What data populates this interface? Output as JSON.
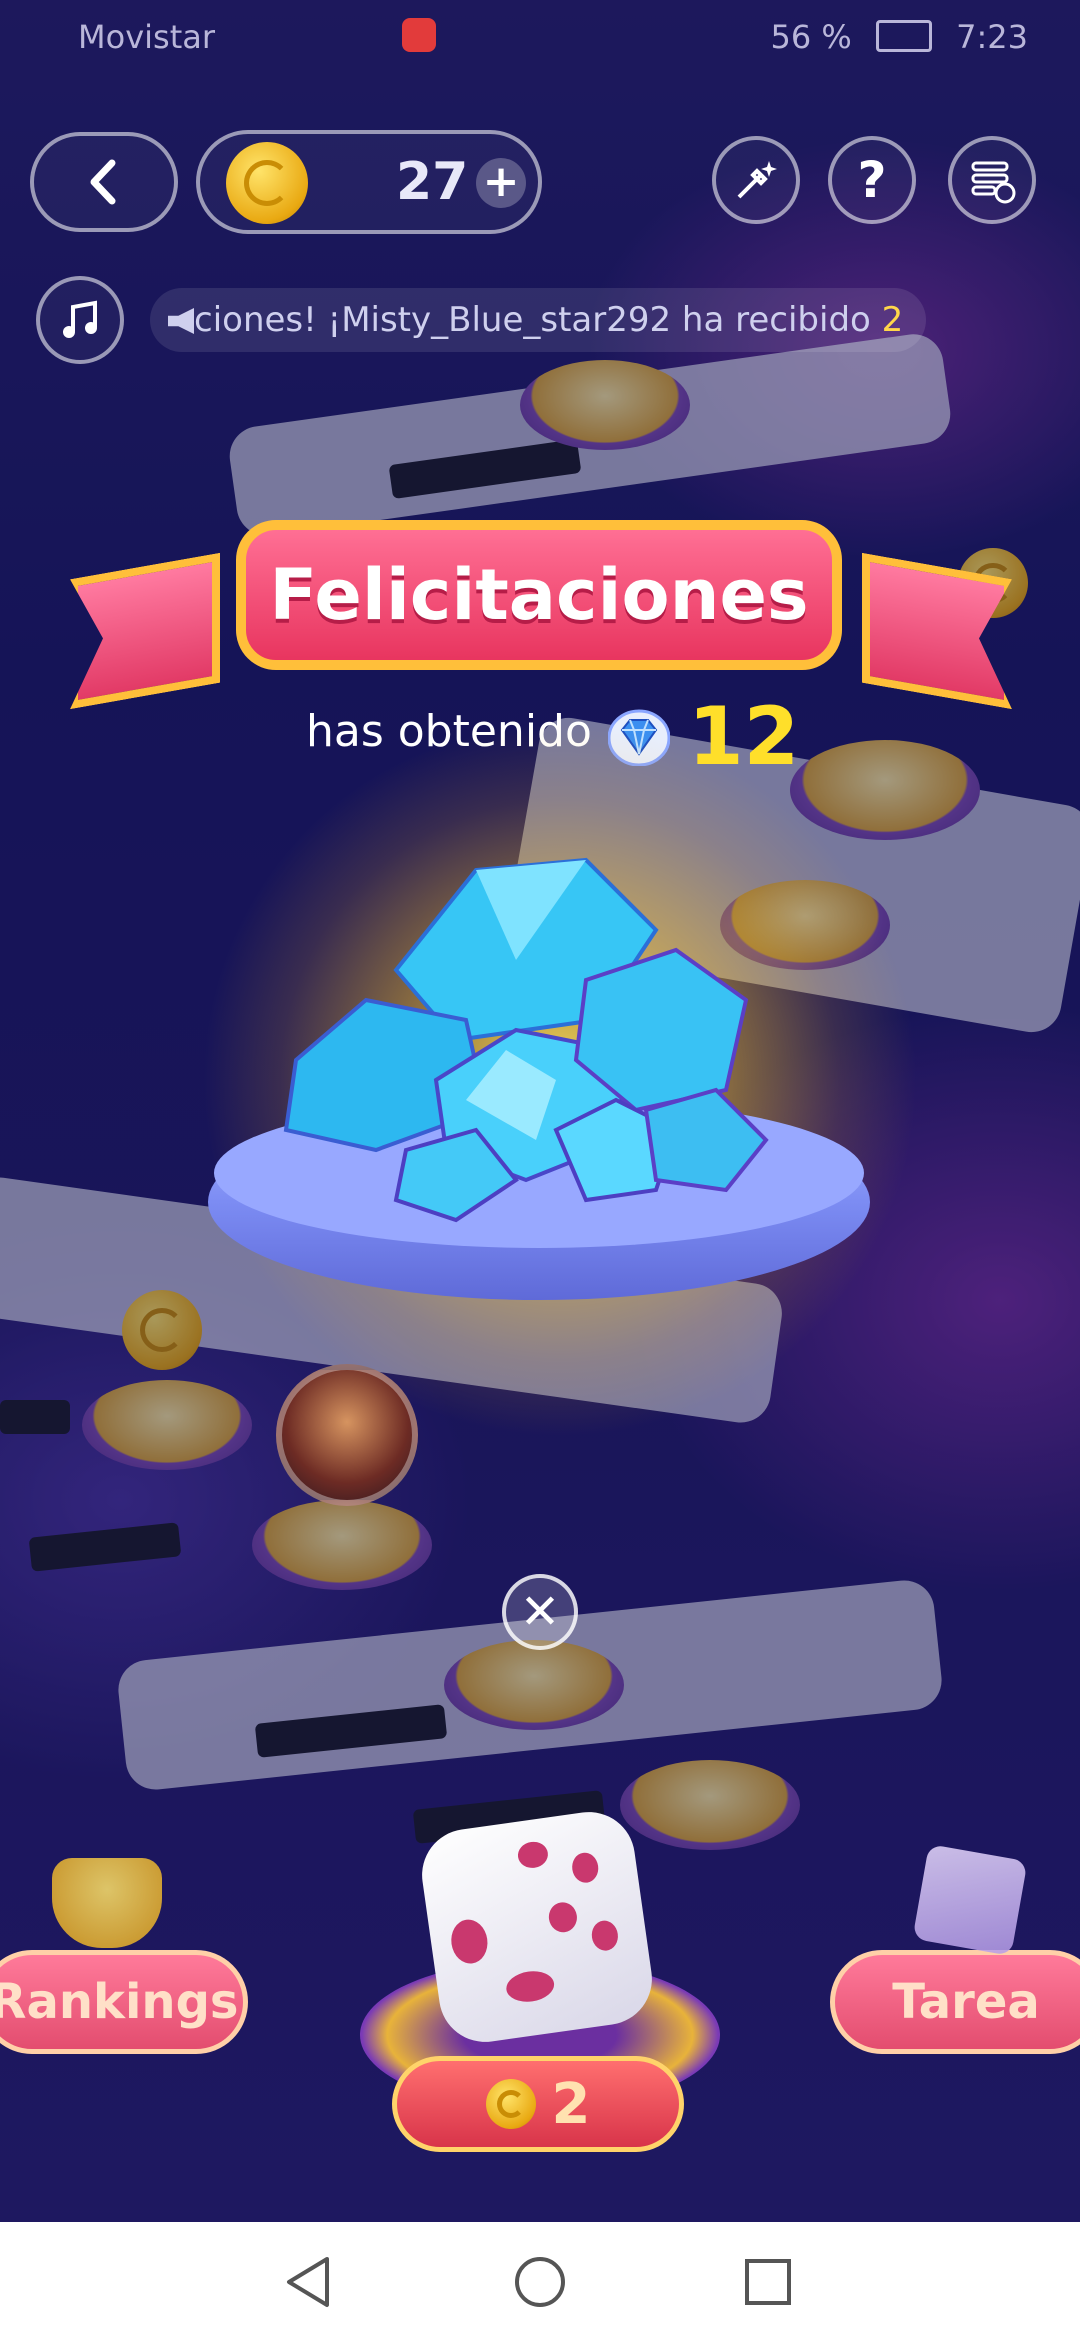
{
  "status_bar": {
    "carrier": "Movistar",
    "battery": "56 %",
    "time": "7:23"
  },
  "header": {
    "coin_count": "27",
    "add_symbol": "+"
  },
  "ticker": {
    "text": "ciones! ¡Misty_Blue_star292 ha recibido",
    "highlight": "2"
  },
  "reward": {
    "title": "Felicitaciones",
    "subtitle": "has obtenido",
    "amount": "12"
  },
  "bottom": {
    "rankings_label": "Rankings",
    "task_label": "Tarea",
    "roll_cost": "2"
  },
  "colors": {
    "accent_gold": "#ffdf2a",
    "ribbon_pink": "#e8355f",
    "background": "#1d1a66"
  }
}
